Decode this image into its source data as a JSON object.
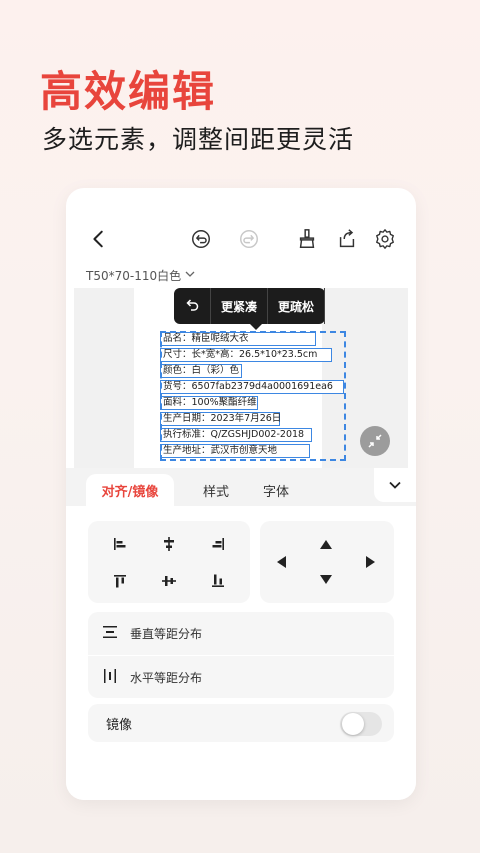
{
  "headline": "高效编辑",
  "subheadline": "多选元素，调整间距更灵活",
  "toolbar": {
    "back_icon": "back-arrow-icon",
    "undo_icon": "undo-icon",
    "redo_icon": "redo-icon",
    "clear_icon": "brush-icon",
    "share_icon": "share-icon",
    "settings_icon": "gear-icon"
  },
  "template": {
    "name": "T50*70-110白色"
  },
  "popover": {
    "undo_icon": "undo-icon",
    "tighter_label": "更紧凑",
    "looser_label": "更疏松"
  },
  "label_fields": [
    "品名：精臣呢绒大衣",
    "尺寸：长*宽*高：26.5*10*23.5cm",
    "颜色：白（彩）色",
    "货号：6507fab2379d4a0001691ea6",
    "面料：100%聚酯纤维",
    "生产日期：2023年7月26日",
    "执行标准：Q/ZGSHJD002-2018",
    "生产地址：武汉市创意天地"
  ],
  "tabs": [
    {
      "label": "对齐/镜像",
      "active": true
    },
    {
      "label": "样式",
      "active": false
    },
    {
      "label": "字体",
      "active": false
    }
  ],
  "distribute": {
    "vertical_label": "垂直等距分布",
    "horizontal_label": "水平等距分布"
  },
  "mirror": {
    "label": "镜像",
    "enabled": false
  },
  "colors": {
    "accent": "#e8453c",
    "selection": "#3d87e2"
  }
}
